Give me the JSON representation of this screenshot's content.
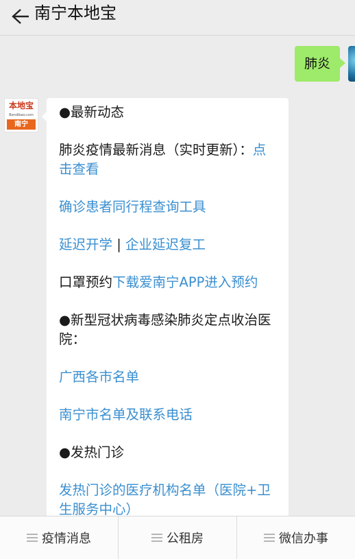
{
  "header": {
    "title": "南宁本地宝"
  },
  "user_message": {
    "text": "肺炎"
  },
  "bot": {
    "avatar": {
      "logo_top": "本地宝",
      "logo_url": "Bendibao.com",
      "logo_city": "南宁"
    },
    "items": [
      {
        "prefix": "●最新动态"
      },
      {
        "prefix": "肺炎疫情最新消息（实时更新）：",
        "link": "点击查看"
      },
      {
        "link": "确诊患者同行程查询工具"
      },
      {
        "link": "延迟开学",
        "sep": " | ",
        "link2": "企业延迟复工"
      },
      {
        "prefix": "口罩预约",
        "link": "下载爱南宁APP进入预约"
      },
      {
        "prefix": "●新型冠状病毒感染肺炎定点收治医院："
      },
      {
        "link": "广西各市名单"
      },
      {
        "link": "南宁市名单及联系电话"
      },
      {
        "prefix": "●发热门诊"
      },
      {
        "link": "发热门诊的医疗机构名单（医院+卫生服务中心）"
      }
    ]
  },
  "bottom_menu": [
    {
      "label": "疫情消息"
    },
    {
      "label": "公租房"
    },
    {
      "label": "微信办事"
    }
  ],
  "colors": {
    "link": "#3a8fd0",
    "user_bubble": "#9eea6a",
    "header_bg": "#ededed"
  }
}
